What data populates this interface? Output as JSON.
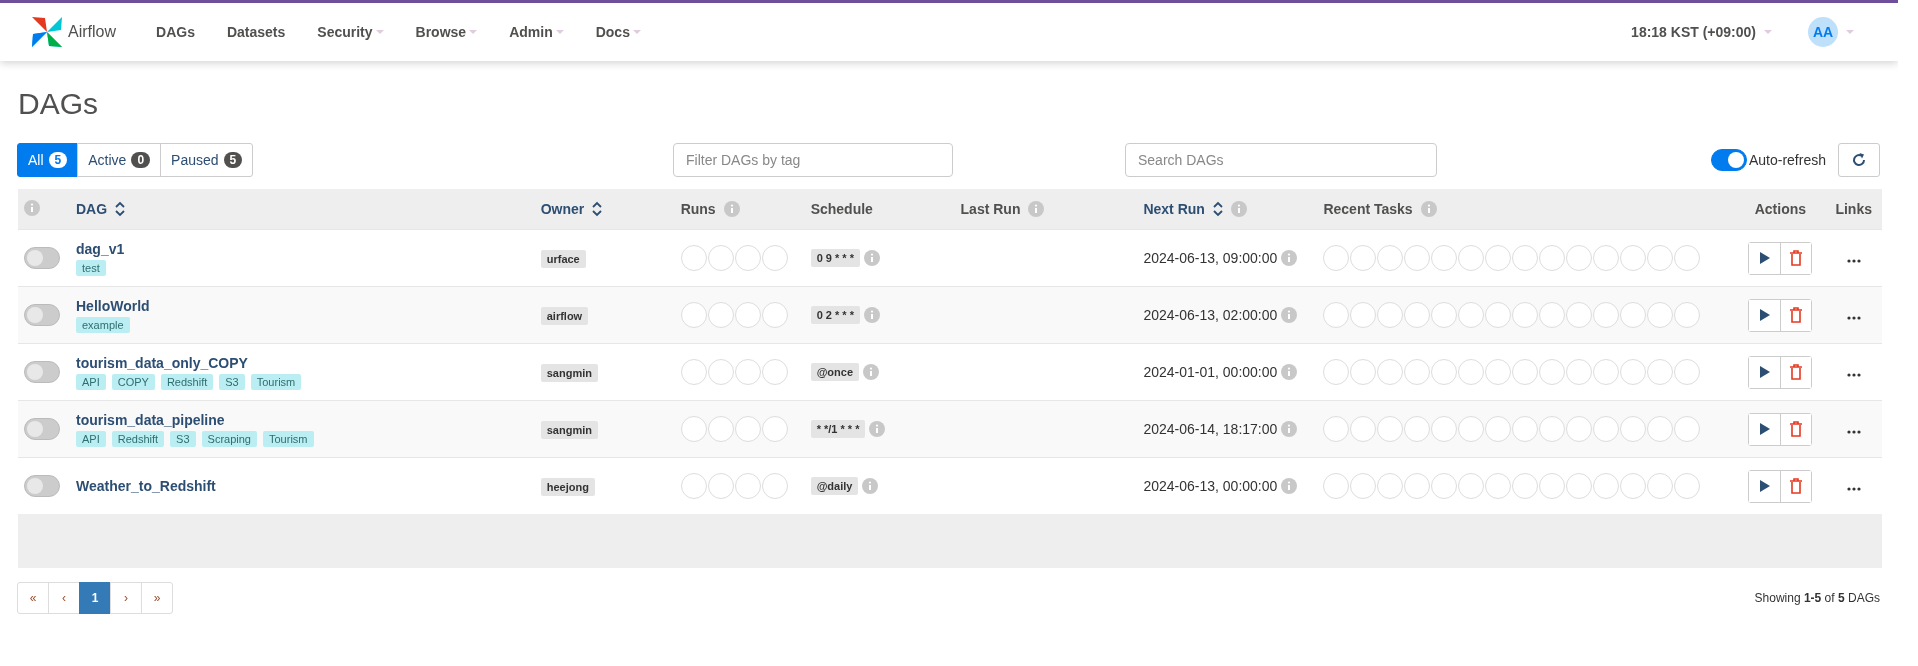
{
  "brand": "Airflow",
  "nav": [
    {
      "label": "DAGs",
      "dropdown": false
    },
    {
      "label": "Datasets",
      "dropdown": false
    },
    {
      "label": "Security",
      "dropdown": true
    },
    {
      "label": "Browse",
      "dropdown": true
    },
    {
      "label": "Admin",
      "dropdown": true
    },
    {
      "label": "Docs",
      "dropdown": true
    }
  ],
  "clock": "18:18 KST (+09:00)",
  "user_initials": "AA",
  "page_title": "DAGs",
  "status_filters": [
    {
      "label": "All",
      "count": "5",
      "selected": true
    },
    {
      "label": "Active",
      "count": "0",
      "selected": false
    },
    {
      "label": "Paused",
      "count": "5",
      "selected": false
    }
  ],
  "tag_filter": {
    "placeholder": "Filter DAGs by tag"
  },
  "search": {
    "placeholder": "Search DAGs"
  },
  "auto_refresh": {
    "label": "Auto-refresh",
    "on": true
  },
  "table": {
    "columns": [
      {
        "label": "DAG",
        "sortable": true,
        "info": false
      },
      {
        "label": "Owner",
        "sortable": true,
        "info": false
      },
      {
        "label": "Runs",
        "sortable": false,
        "info": true
      },
      {
        "label": "Schedule",
        "sortable": false,
        "info": false
      },
      {
        "label": "Last Run",
        "sortable": false,
        "info": true
      },
      {
        "label": "Next Run",
        "sortable": true,
        "info": true
      },
      {
        "label": "Recent Tasks",
        "sortable": false,
        "info": true
      },
      {
        "label": "Actions",
        "sortable": false,
        "info": false
      },
      {
        "label": "Links",
        "sortable": false,
        "info": false
      }
    ],
    "rows": [
      {
        "on": false,
        "name": "dag_v1",
        "tags": [
          "test"
        ],
        "owner": "urface",
        "schedule": "0 9 * * *",
        "next_run": "2024-06-13, 09:00:00"
      },
      {
        "on": false,
        "name": "HelloWorld",
        "tags": [
          "example"
        ],
        "owner": "airflow",
        "schedule": "0 2 * * *",
        "next_run": "2024-06-13, 02:00:00"
      },
      {
        "on": false,
        "name": "tourism_data_only_COPY",
        "tags": [
          "API",
          "COPY",
          "Redshift",
          "S3",
          "Tourism"
        ],
        "owner": "sangmin",
        "schedule": "@once",
        "next_run": "2024-01-01, 00:00:00"
      },
      {
        "on": false,
        "name": "tourism_data_pipeline",
        "tags": [
          "API",
          "Redshift",
          "S3",
          "Scraping",
          "Tourism"
        ],
        "owner": "sangmin",
        "schedule": "* */1 * * *",
        "next_run": "2024-06-14, 18:17:00"
      },
      {
        "on": false,
        "name": "Weather_to_Redshift",
        "tags": [],
        "owner": "heejong",
        "schedule": "@daily",
        "next_run": "2024-06-13, 00:00:00"
      }
    ]
  },
  "pagination": [
    {
      "label": "«",
      "selected": false
    },
    {
      "label": "‹",
      "selected": false
    },
    {
      "label": "1",
      "selected": true
    },
    {
      "label": "›",
      "selected": false
    },
    {
      "label": "»",
      "selected": false
    }
  ],
  "summary": "Showing **1-5** of **5** DAGs"
}
